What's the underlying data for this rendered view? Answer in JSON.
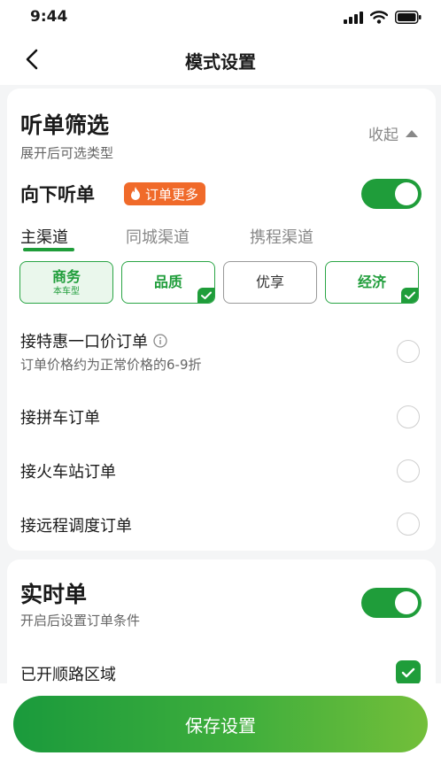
{
  "status_bar": {
    "time": "9:44"
  },
  "nav": {
    "title": "模式设置"
  },
  "filter": {
    "title": "听单筛选",
    "subtitle": "展开后可选类型",
    "collapse_label": "收起",
    "down_listen_label": "向下听单",
    "badge_label": "订单更多",
    "down_listen_on": true,
    "tabs": [
      {
        "label": "主渠道",
        "active": true
      },
      {
        "label": "同城渠道",
        "active": false
      },
      {
        "label": "携程渠道",
        "active": false
      }
    ],
    "car_types": [
      {
        "label": "商务",
        "sub": "本车型",
        "style": "selected-outline",
        "checked": false
      },
      {
        "label": "品质",
        "sub": "",
        "style": "green",
        "checked": true
      },
      {
        "label": "优享",
        "sub": "",
        "style": "off",
        "checked": false
      },
      {
        "label": "经济",
        "sub": "",
        "style": "green",
        "checked": true
      }
    ],
    "options": [
      {
        "label": "接特惠一口价订单",
        "desc": "订单价格约为正常价格的6-9折",
        "checked": false
      },
      {
        "label": "接拼车订单",
        "checked": false
      },
      {
        "label": "接火车站订单",
        "checked": false
      },
      {
        "label": "接远程调度订单",
        "checked": false
      }
    ]
  },
  "realtime": {
    "title": "实时单",
    "subtitle": "开启后设置订单条件",
    "enabled": true,
    "route_label": "已开顺路区域",
    "route_checked": true
  },
  "save_button": {
    "label": "保存设置"
  },
  "colors": {
    "accent": "#1f9d3a",
    "badge": "#f06a2a"
  }
}
